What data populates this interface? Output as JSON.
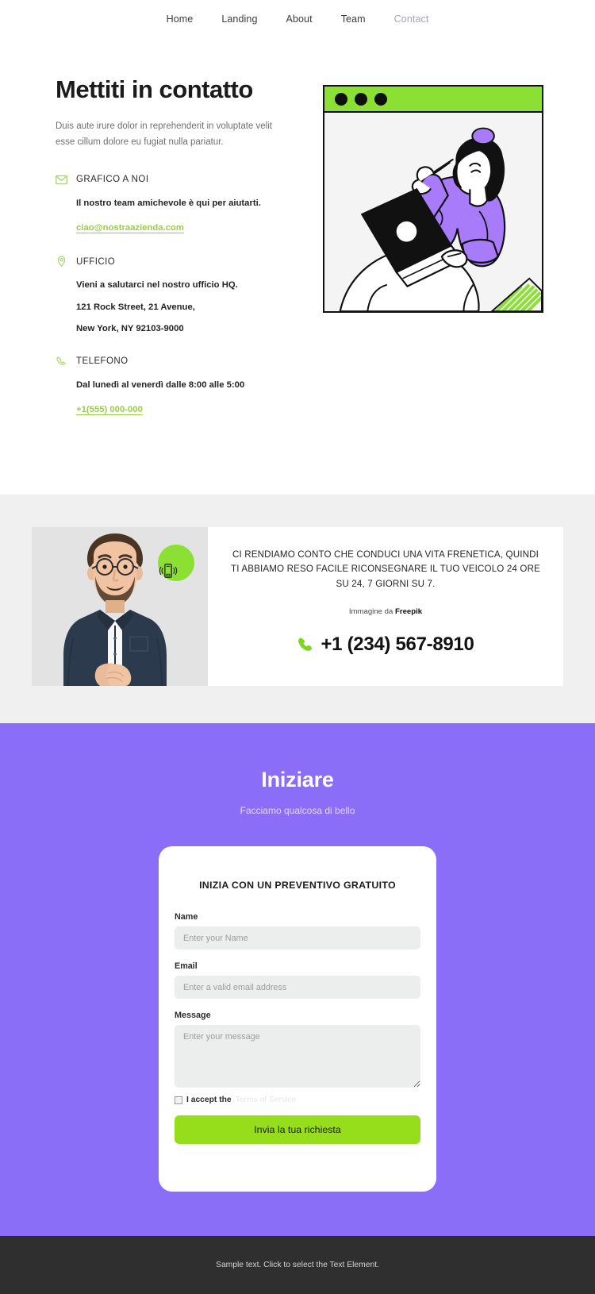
{
  "nav": {
    "items": [
      {
        "label": "Home",
        "active": false
      },
      {
        "label": "Landing",
        "active": false
      },
      {
        "label": "About",
        "active": false
      },
      {
        "label": "Team",
        "active": false
      },
      {
        "label": "Contact",
        "active": true
      }
    ]
  },
  "hero": {
    "title": "Mettiti in contatto",
    "subtitle": "Duis aute irure dolor in reprehenderit in voluptate velit esse cillum dolore eu fugiat nulla pariatur.",
    "contacts": [
      {
        "icon": "envelope-icon",
        "label": "GRAFICO A NOI",
        "lines": [
          "Il nostro team amichevole è qui per aiutarti."
        ],
        "link": "ciao@nostraazienda.com"
      },
      {
        "icon": "map-pin-icon",
        "label": "UFFICIO",
        "lines": [
          "Vieni a salutarci nel nostro ufficio HQ.",
          "121 Rock Street, 21 Avenue,",
          "New York, NY 92103-9000"
        ],
        "link": ""
      },
      {
        "icon": "phone-icon",
        "label": "TELEFONO",
        "lines": [
          "Dal lunedì al venerdì dalle 8:00 alle 5:00"
        ],
        "link": "+1(555) 000-000"
      }
    ],
    "illustration": {
      "name": "person-with-laptop-illustration",
      "window_dots": 3,
      "bar_color": "#8CE033"
    }
  },
  "banner": {
    "photo_alt": "bearded-man-in-navy-shirt-photo",
    "badge_icon": "vibrating-phone-icon",
    "headline": "CI RENDIAMO CONTO CHE CONDUCI UNA VITA FRENETICA, QUINDI TI ABBIAMO RESO FACILE RICONSEGNARE IL TUO VEICOLO 24 ORE SU 24, 7 GIORNI SU 7.",
    "credit_prefix": "Immagine da ",
    "credit_source": "Freepik",
    "phone_icon": "phone-icon",
    "phone": "+1 (234) 567-8910"
  },
  "form_section": {
    "title": "Iniziare",
    "subtitle": "Facciamo qualcosa di bello",
    "card_title": "INIZIA CON UN PREVENTIVO GRATUITO",
    "fields": {
      "name": {
        "label": "Name",
        "placeholder": "Enter your Name",
        "value": ""
      },
      "email": {
        "label": "Email",
        "placeholder": "Enter a valid email address",
        "value": ""
      },
      "message": {
        "label": "Message",
        "placeholder": "Enter your message",
        "value": ""
      }
    },
    "accept_text": "I accept the",
    "accept_link": "Terms of Service",
    "submit_label": "Invia la tua richiesta"
  },
  "footer": {
    "text": "Sample text. Click to select the Text Element."
  },
  "colors": {
    "accent_green": "#8CE033",
    "button_green": "#96DE1C",
    "accent_purple": "#8B6EF7",
    "link_green": "#9ccb4e",
    "banner_bg": "#f0f0f0",
    "footer_bg": "#2f2f2f"
  }
}
